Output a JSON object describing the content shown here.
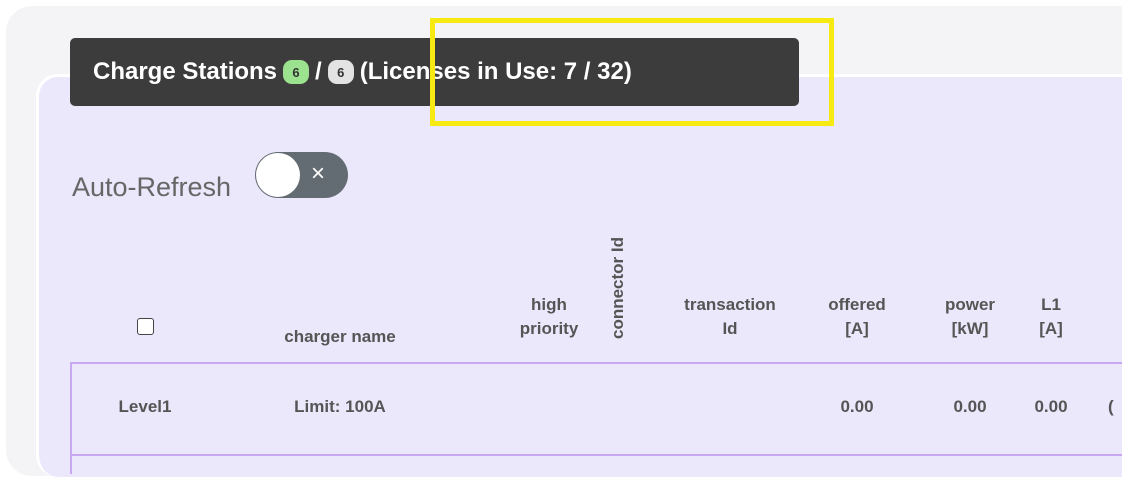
{
  "header": {
    "title": "Charge Stations",
    "badge_active": "6",
    "separator": "/",
    "badge_total": "6",
    "licenses": "(Licenses in Use: 7 / 32)"
  },
  "auto_refresh": {
    "label": "Auto-Refresh",
    "toggle_symbol": "×",
    "enabled": false
  },
  "table": {
    "headers": {
      "charger_name": "charger name",
      "high_priority": [
        "high",
        "priority"
      ],
      "connector_id": "connector Id",
      "transaction_id": [
        "transaction",
        "Id"
      ],
      "offered": [
        "offered",
        "[A]"
      ],
      "power": [
        "power",
        "[kW]"
      ],
      "l1": [
        "L1",
        "[A]"
      ]
    },
    "rows": [
      {
        "level": "Level1",
        "name": "Limit: 100A",
        "offered": "0.00",
        "power": "0.00",
        "l1": "0.00",
        "next": "("
      }
    ]
  },
  "colors": {
    "header_bg": "#3c3c3c",
    "highlight": "#f6ea12",
    "panel_bg": "#ebe8fb",
    "row_border": "#c9a8f2"
  }
}
